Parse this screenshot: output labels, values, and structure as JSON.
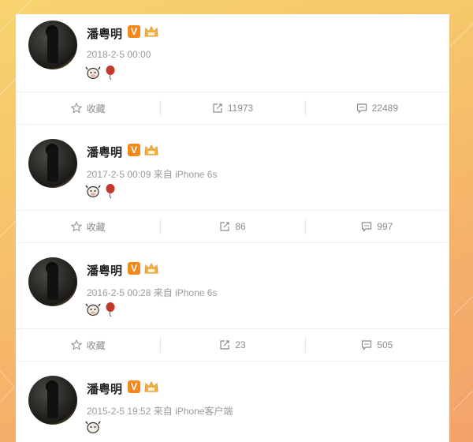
{
  "posts": [
    {
      "author": "潘粤明",
      "verified_badge": "V",
      "meta": "2018-2-5 00:00",
      "emojis": [
        "cow-icon",
        "balloon-icon"
      ],
      "actions": {
        "favorite_label": "收藏",
        "repost_count": "11973",
        "comment_count": "22489"
      }
    },
    {
      "author": "潘粤明",
      "verified_badge": "V",
      "meta": "2017-2-5 00:09 来自 iPhone 6s",
      "emojis": [
        "cow-icon",
        "balloon-icon"
      ],
      "actions": {
        "favorite_label": "收藏",
        "repost_count": "86",
        "comment_count": "997"
      }
    },
    {
      "author": "潘粤明",
      "verified_badge": "V",
      "meta": "2016-2-5 00:28 来自 iPhone 6s",
      "emojis": [
        "cow-icon",
        "balloon-icon"
      ],
      "actions": {
        "favorite_label": "收藏",
        "repost_count": "23",
        "comment_count": "505"
      }
    },
    {
      "author": "潘粤明",
      "verified_badge": "V",
      "meta": "2015-2-5 19:52 来自 iPhone客户端",
      "emojis": [
        "cow-icon"
      ],
      "actions": null
    }
  ],
  "colors": {
    "accent_badge": "#f28a1b",
    "meta_text": "#9b9b9b",
    "balloon": "#c0392b"
  }
}
